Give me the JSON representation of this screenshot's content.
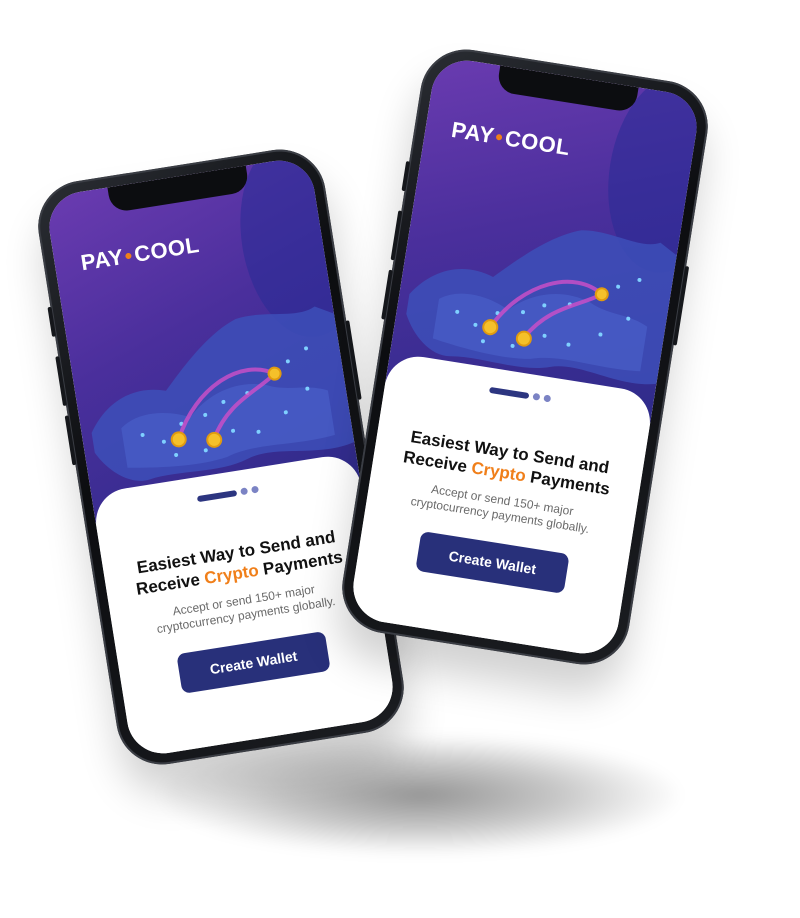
{
  "phones": [
    {
      "id": "left",
      "brand_left": "PAY",
      "brand_right": "COOL",
      "headline_line1": "Easiest Way to Send and",
      "headline_prefix": "Receive",
      "headline_accent": "Crypto",
      "headline_suffix": "Payments",
      "subtext_line1": "Accept or send 150+ major",
      "subtext_line2": "cryptocurrency payments globally.",
      "cta_label": "Create Wallet"
    },
    {
      "id": "right",
      "brand_left": "PAY",
      "brand_right": "COOL",
      "headline_line1": "Easiest Way to Send and",
      "headline_prefix": "Receive",
      "headline_accent": "Crypto",
      "headline_suffix": "Payments",
      "subtext_line1": "Accept or send 150+ major",
      "subtext_line2": "cryptocurrency payments globally.",
      "cta_label": "Create Wallet"
    }
  ],
  "colors": {
    "hero_purple": "#4a2f9c",
    "accent_orange": "#f07f1a",
    "button_navy": "#28307a",
    "pager_active": "#2c3580",
    "pager_inactive": "#7b83c4"
  },
  "pager": {
    "total_pages": 3,
    "active_page": 1
  }
}
